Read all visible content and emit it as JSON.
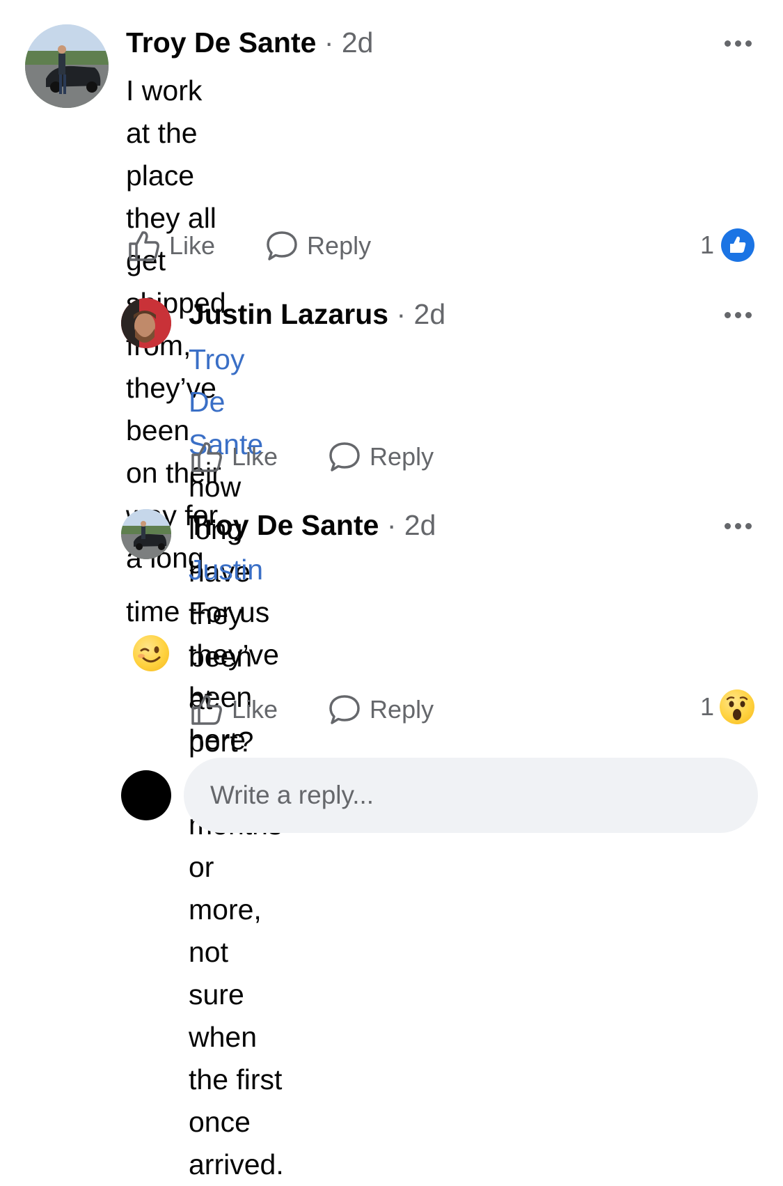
{
  "comments": [
    {
      "author": "Troy De Sante",
      "time": "2d",
      "line1": "I work at the place they all get shipped",
      "line2": "from, they’ve been on their way for a long",
      "line3": "time",
      "emoji": "winking-face",
      "like_label": "Like",
      "reply_label": "Reply",
      "reaction_count": "1",
      "reaction_type": "like"
    },
    {
      "author": "Justin Lazarus",
      "time": "2d",
      "mention": "Troy De Sante",
      "line1_rest": " how long have they been",
      "line2": "at port?",
      "like_label": "Like",
      "reply_label": "Reply"
    },
    {
      "author": "Troy De Sante",
      "time": "2d",
      "mention": "Justin",
      "line1_rest": " For us they’ve been here for 2",
      "line2": "months or more, not sure when the first",
      "line3": "once arrived.",
      "like_label": "Like",
      "reply_label": "Reply",
      "reaction_count": "1",
      "reaction_type": "wow"
    }
  ],
  "composer": {
    "placeholder": "Write a reply..."
  },
  "colors": {
    "mention": "#3a6fc6",
    "like_blue": "#1b74e4",
    "meta_gray": "#65676b"
  }
}
